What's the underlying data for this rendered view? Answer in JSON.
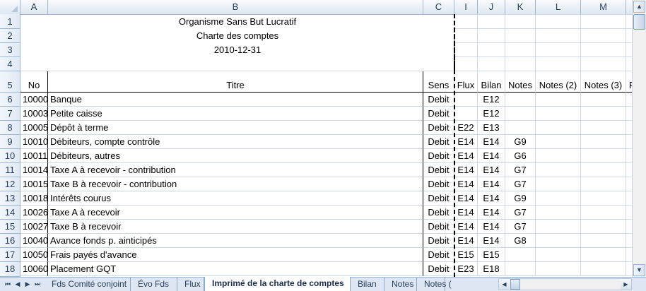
{
  "columns": [
    "A",
    "B",
    "C",
    "I",
    "J",
    "K",
    "L",
    "M"
  ],
  "org_title": "Organisme Sans But Lucratif",
  "sheet_title": "Charte des comptes",
  "date": "2010-12-31",
  "row_numbers": [
    "1",
    "2",
    "3",
    "4",
    "5",
    "6",
    "7",
    "8",
    "9",
    "10",
    "11",
    "12",
    "13",
    "14",
    "15",
    "16",
    "17",
    "18"
  ],
  "headers": {
    "no": "No",
    "titre": "Titre",
    "sens": "Sens",
    "flux": "Flux",
    "bilan": "Bilan",
    "notes": "Notes",
    "notes2": "Notes (2)",
    "notes3": "Notes (3)",
    "partial": "R"
  },
  "rows": [
    {
      "no": "10000",
      "titre": "Banque",
      "sens": "Debit",
      "flux": "",
      "bilan": "E12",
      "notes": ""
    },
    {
      "no": "10003",
      "titre": "Petite caisse",
      "sens": "Debit",
      "flux": "",
      "bilan": "E12",
      "notes": ""
    },
    {
      "no": "10005",
      "titre": "Dépôt à terme",
      "sens": "Debit",
      "flux": "E22",
      "bilan": "E13",
      "notes": ""
    },
    {
      "no": "10010",
      "titre": "Débiteurs, compte contrôle",
      "sens": "Debit",
      "flux": "E14",
      "bilan": "E14",
      "notes": "G9"
    },
    {
      "no": "10011",
      "titre": "Débiteurs, autres",
      "sens": "Debit",
      "flux": "E14",
      "bilan": "E14",
      "notes": "G6"
    },
    {
      "no": "10014",
      "titre": "Taxe A à recevoir - contribution",
      "sens": "Debit",
      "flux": "E14",
      "bilan": "E14",
      "notes": "G7"
    },
    {
      "no": "10015",
      "titre": "Taxe B à recevoir - contribution",
      "sens": "Debit",
      "flux": "E14",
      "bilan": "E14",
      "notes": "G7"
    },
    {
      "no": "10018",
      "titre": "Intérêts courus",
      "sens": "Debit",
      "flux": "E14",
      "bilan": "E14",
      "notes": "G9"
    },
    {
      "no": "10026",
      "titre": "Taxe A à recevoir",
      "sens": "Debit",
      "flux": "E14",
      "bilan": "E14",
      "notes": "G7"
    },
    {
      "no": "10027",
      "titre": "Taxe B à recevoir",
      "sens": "Debit",
      "flux": "E14",
      "bilan": "E14",
      "notes": "G7"
    },
    {
      "no": "10040",
      "titre": "Avance fonds p. ainticipés",
      "sens": "Debit",
      "flux": "E14",
      "bilan": "E14",
      "notes": "G8"
    },
    {
      "no": "10050",
      "titre": "Frais payés d'avance",
      "sens": "Debit",
      "flux": "E15",
      "bilan": "E15",
      "notes": ""
    },
    {
      "no": "10060",
      "titre": "Placement GQT",
      "sens": "Debit",
      "flux": "E23",
      "bilan": "E18",
      "notes": ""
    }
  ],
  "tabs": [
    "Fds Comité conjoint",
    "Évo Fds",
    "Flux",
    "Imprimé de la charte de comptes",
    "Bilan",
    "Notes",
    "Notes ("
  ],
  "active_tab": "Imprimé de la charte de comptes"
}
